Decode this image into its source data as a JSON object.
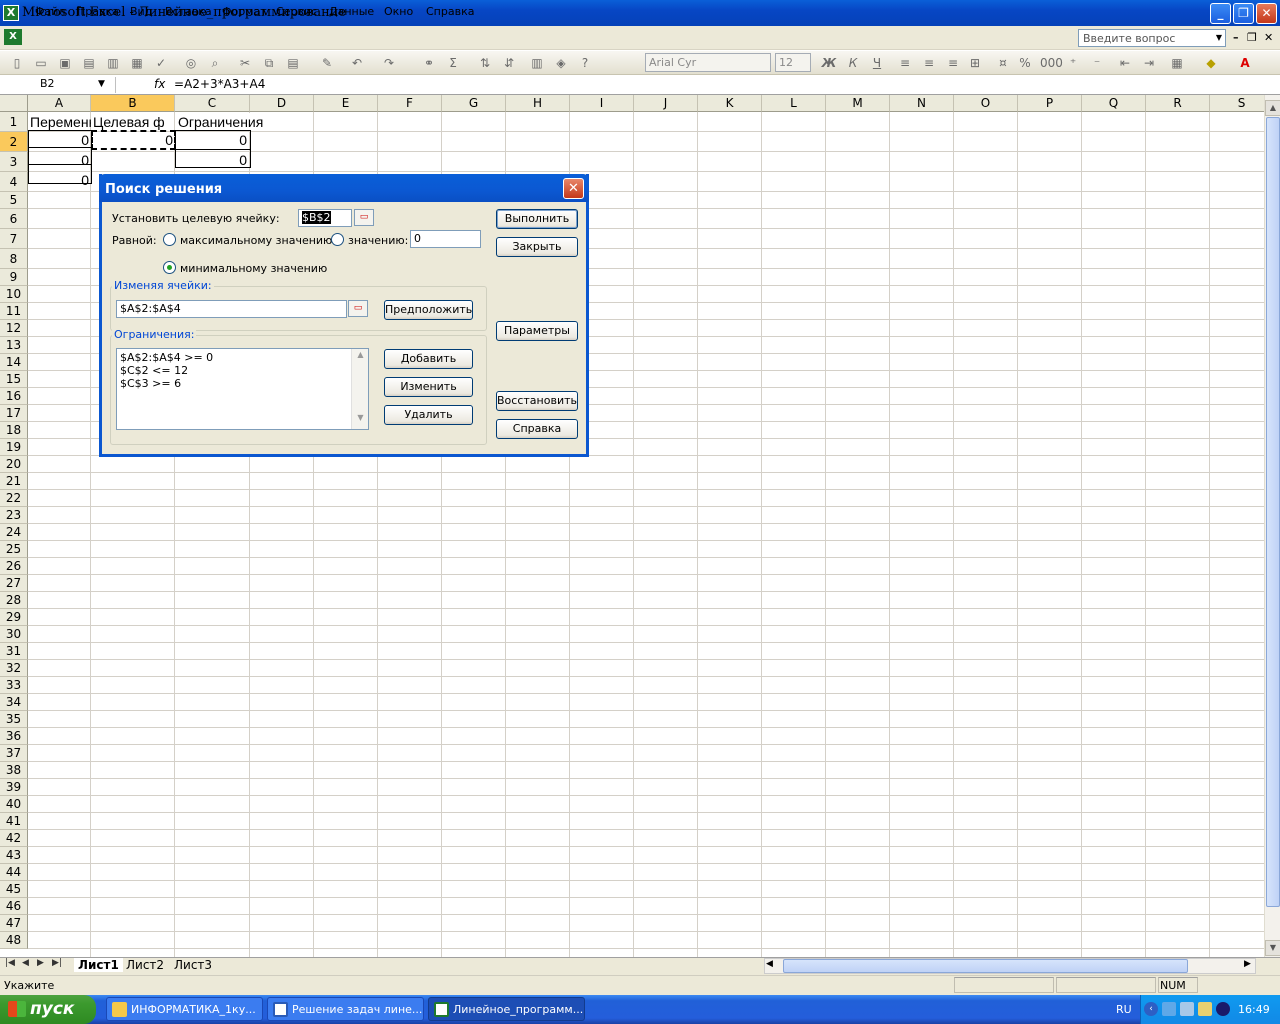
{
  "window": {
    "title": "Microsoft Excel - Линейное_программирование",
    "minimize": "_",
    "restore": "❐",
    "close": "✕"
  },
  "menu": [
    "Файл",
    "Правка",
    "Вид",
    "Вставка",
    "Формат",
    "Сервис",
    "Данные",
    "Окно",
    "Справка"
  ],
  "question_placeholder": "Введите вопрос",
  "toolbar": {
    "font": "Arial Cyr",
    "size": "12",
    "bold": "Ж",
    "italic": "К",
    "underline": "Ч"
  },
  "formula_bar": {
    "cell_ref": "B2",
    "fx": "fx",
    "formula": "=A2+3*A3+A4"
  },
  "columns": [
    "A",
    "B",
    "C",
    "D",
    "E",
    "F",
    "G",
    "H",
    "I",
    "J",
    "K",
    "L",
    "M",
    "N",
    "O",
    "P",
    "Q",
    "R",
    "S"
  ],
  "rows": [
    "1",
    "2",
    "3",
    "4",
    "5",
    "6",
    "7",
    "8",
    "9",
    "10",
    "11",
    "12",
    "13",
    "14",
    "15",
    "16",
    "17",
    "18",
    "19",
    "20",
    "21",
    "22",
    "23",
    "24",
    "25",
    "26",
    "27",
    "28",
    "29",
    "30",
    "31",
    "32",
    "33",
    "34",
    "35",
    "36",
    "37",
    "38",
    "39",
    "40",
    "41",
    "42",
    "43",
    "44",
    "45",
    "46",
    "47",
    "48"
  ],
  "cells": {
    "A1": "Переменные",
    "B1": "Целевая ф",
    "C1": "Ограничения",
    "A2": "0",
    "B2": "0",
    "C2": "0",
    "A3": "0",
    "C3": "0",
    "A4": "0"
  },
  "sheets": [
    "Лист1",
    "Лист2",
    "Лист3"
  ],
  "active_sheet": "Лист1",
  "status": {
    "text": "Укажите",
    "num": "NUM"
  },
  "dialog": {
    "title": "Поиск решения",
    "target_label": "Установить целевую ячейку:",
    "target_value": "$B$2",
    "equal_label": "Равной:",
    "opt_max": "максимальному значению",
    "opt_value": "значению:",
    "value_input": "0",
    "opt_min": "минимальному значению",
    "changing_label": "Изменяя ячейки:",
    "changing_value": "$A$2:$A$4",
    "guess_button": "Предположить",
    "constraints_label": "Ограничения:",
    "constraints": [
      "$A$2:$A$4 >= 0",
      "$C$2 <= 12",
      "$C$3 >= 6"
    ],
    "add_button": "Добавить",
    "change_button": "Изменить",
    "delete_button": "Удалить",
    "solve_button": "Выполнить",
    "close_button": "Закрыть",
    "options_button": "Параметры",
    "reset_button": "Восстановить",
    "help_button": "Справка",
    "selected_option": "min"
  },
  "taskbar": {
    "start": "пуск",
    "tasks": [
      "ИНФОРМАТИКА_1ку...",
      "Решение задач лине...",
      "Линейное_программ..."
    ],
    "lang": "RU",
    "clock": "16:49"
  }
}
